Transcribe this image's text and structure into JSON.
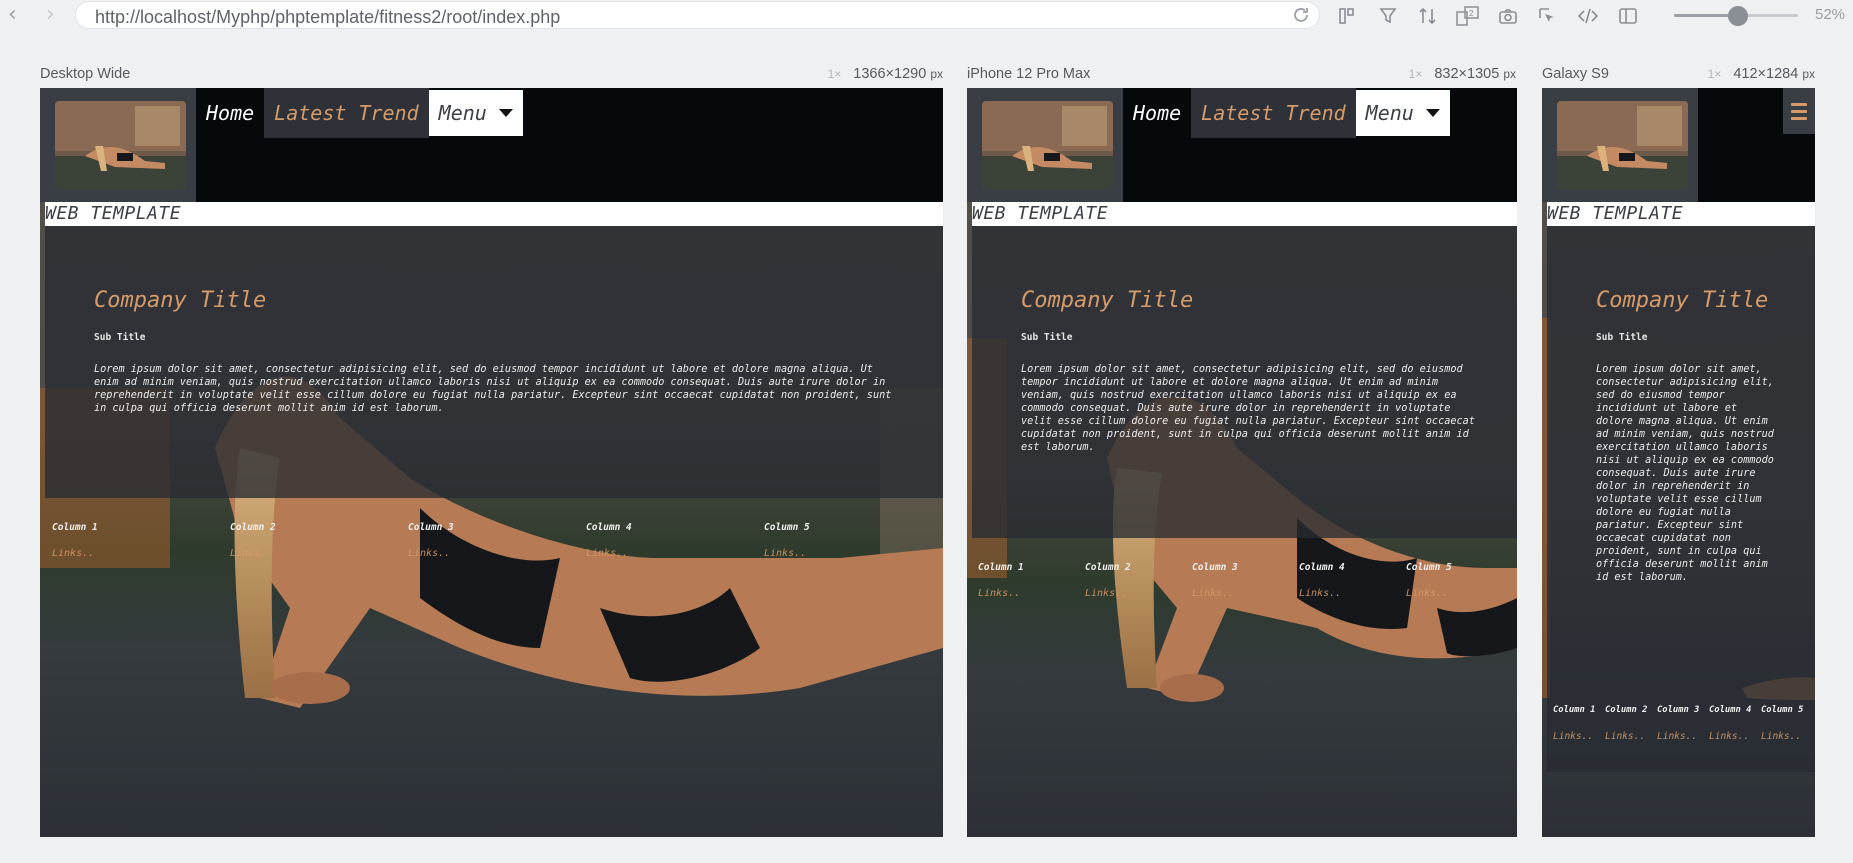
{
  "browser": {
    "url": "http://localhost/Myphp/phptemplate/fitness2/root/index.php",
    "zoom_label": "52%",
    "zoom_level": 0.52
  },
  "devices": [
    {
      "name": "Desktop Wide",
      "dpr": "1×",
      "width": "1366",
      "height": "1290",
      "unit": "px"
    },
    {
      "name": "iPhone 12 Pro Max",
      "dpr": "1×",
      "width": "832",
      "height": "1305",
      "unit": "px"
    },
    {
      "name": "Galaxy S9",
      "dpr": "1×",
      "width": "412",
      "height": "1284",
      "unit": "px"
    }
  ],
  "site": {
    "menu": {
      "home": "Home",
      "trend": "Latest Trend",
      "menu": "Menu"
    },
    "banner": "WEB TEMPLATE",
    "company_title": "Company Title",
    "sub_title": "Sub Title",
    "lorem": "Lorem ipsum dolor sit amet, consectetur adipisicing elit, sed do eiusmod tempor incididunt ut labore et dolore magna aliqua. Ut enim ad minim veniam, quis nostrud exercitation ullamco laboris nisi ut aliquip ex ea commodo consequat. Duis aute irure dolor in reprehenderit in voluptate velit esse cillum dolore eu fugiat nulla pariatur. Excepteur sint occaecat cupidatat non proident, sunt in culpa qui officia deserunt mollit anim id est laborum.",
    "columns": [
      {
        "title": "Column 1",
        "link": "Links.."
      },
      {
        "title": "Column 2",
        "link": "Links.."
      },
      {
        "title": "Column 3",
        "link": "Links.."
      },
      {
        "title": "Column 4",
        "link": "Links.."
      },
      {
        "title": "Column 5",
        "link": "Links.."
      }
    ]
  },
  "colors": {
    "accent": "#d69b6a",
    "header_bg": "#05090c",
    "panel_bg": "#2e3238"
  }
}
